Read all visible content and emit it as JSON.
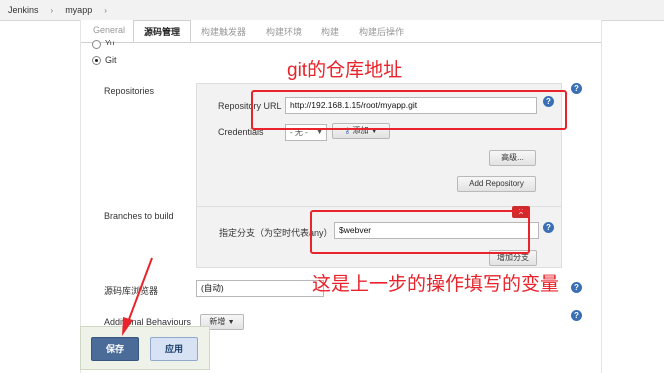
{
  "breadcrumb": {
    "items": [
      "Jenkins",
      "myapp"
    ],
    "separator": "›"
  },
  "tabs": [
    "General",
    "源码管理",
    "构建触发器",
    "构建环境",
    "构建",
    "构建后操作"
  ],
  "scm": {
    "option_cut": "Yu",
    "git_label": "Git"
  },
  "repositories": {
    "label": "Repositories",
    "url_label": "Repository URL",
    "url_value": "http://192.168.1.15/root/myapp.git",
    "credentials_label": "Credentials",
    "credentials_value": "- 无 -",
    "add_button": "添加",
    "advanced_button": "高级...",
    "add_repository_button": "Add Repository"
  },
  "branches": {
    "label": "Branches to build",
    "branch_label": "指定分支（为空时代表any）",
    "branch_value": "$webver",
    "delete_button": "x",
    "add_branch_button": "增加分支"
  },
  "browser": {
    "label": "源码库浏览器",
    "value": "(自动)"
  },
  "behaviours": {
    "label": "Additional Behaviours",
    "add_button": "新增"
  },
  "actions": {
    "save": "保存",
    "apply": "应用"
  },
  "annotations": {
    "git_repo": "git的仓库地址",
    "variable": "这是上一步的操作填写的变量"
  },
  "colors": {
    "annotation": "#e8232b",
    "help": "#3a6fb6",
    "save": "#4b6c99"
  }
}
